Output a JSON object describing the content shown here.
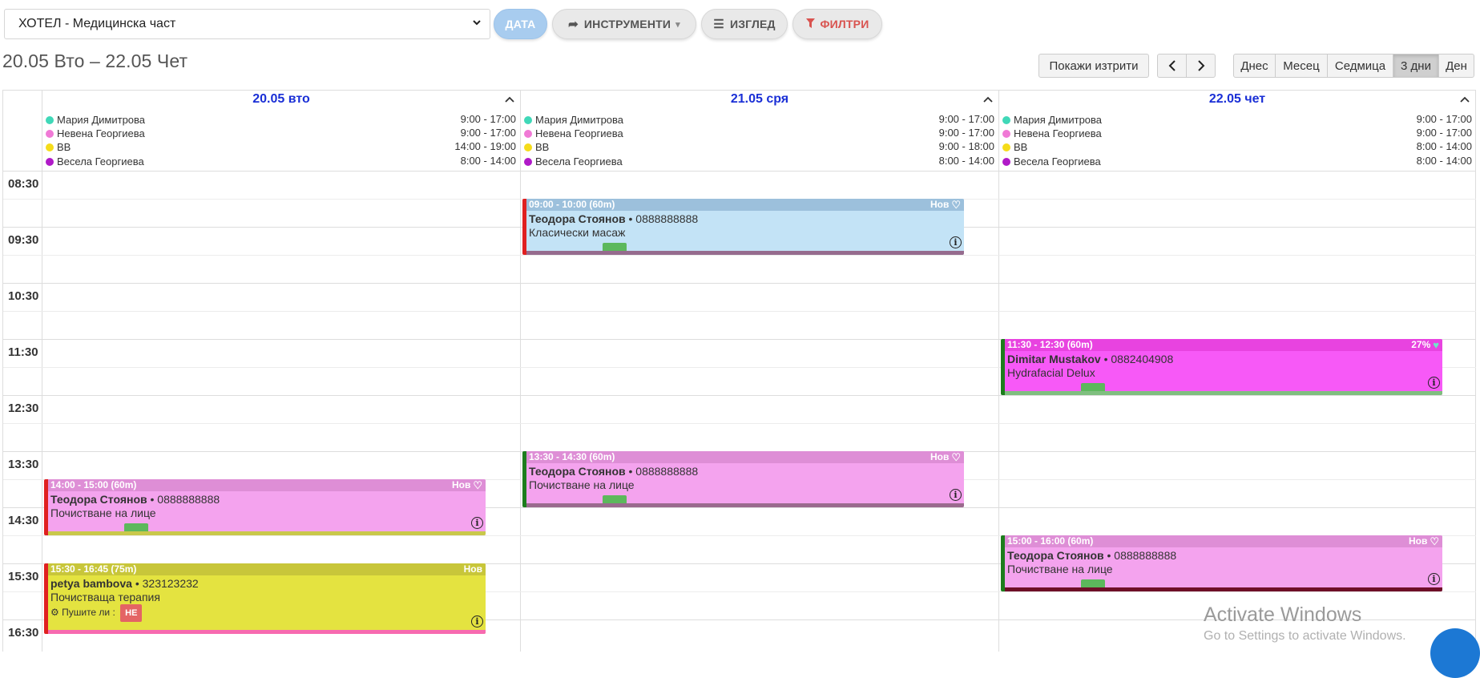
{
  "toolbar": {
    "location_select": "ХОТЕЛ - Медицинска част",
    "date_label": "ДАТА",
    "tools_label": "ИНСТРУМЕНТИ",
    "view_label": "ИЗГЛЕД",
    "filters_label": "ФИЛТРИ"
  },
  "range_title": "20.05 Вто – 22.05 Чет",
  "nav": {
    "show_deleted": "Покажи изтрити",
    "prev": "<",
    "next": ">",
    "views": [
      "Днес",
      "Месец",
      "Седмица",
      "3 дни",
      "Ден"
    ],
    "active_view": "3 дни"
  },
  "days": [
    {
      "title": "20.05 вто",
      "staff": [
        {
          "name": "Мария Димитрова",
          "hours": "9:00 - 17:00",
          "color": "#40d8b8"
        },
        {
          "name": "Невена Георгиева",
          "hours": "9:00 - 17:00",
          "color": "#f07ad6"
        },
        {
          "name": "BB",
          "hours": "14:00 - 19:00",
          "color": "#f5dc1a"
        },
        {
          "name": "Весела Георгиева",
          "hours": "8:00 - 14:00",
          "color": "#b01ac8"
        }
      ]
    },
    {
      "title": "21.05 сря",
      "staff": [
        {
          "name": "Мария Димитрова",
          "hours": "9:00 - 17:00",
          "color": "#40d8b8"
        },
        {
          "name": "Невена Георгиева",
          "hours": "9:00 - 17:00",
          "color": "#f07ad6"
        },
        {
          "name": "BB",
          "hours": "9:00 - 18:00",
          "color": "#f5dc1a"
        },
        {
          "name": "Весела Георгиева",
          "hours": "8:00 - 14:00",
          "color": "#b01ac8"
        }
      ]
    },
    {
      "title": "22.05 чет",
      "staff": [
        {
          "name": "Мария Димитрова",
          "hours": "9:00 - 17:00",
          "color": "#40d8b8"
        },
        {
          "name": "Невена Георгиева",
          "hours": "9:00 - 17:00",
          "color": "#f07ad6"
        },
        {
          "name": "BB",
          "hours": "8:00 - 14:00",
          "color": "#f5dc1a"
        },
        {
          "name": "Весела Георгиева",
          "hours": "8:00 - 14:00",
          "color": "#b01ac8"
        }
      ]
    }
  ],
  "times": [
    "08:30",
    "09:30",
    "10:30",
    "11:30",
    "12:30",
    "13:30",
    "14:30",
    "15:30",
    "16:30"
  ],
  "events": [
    {
      "id": "e1",
      "time": "09:00 - 10:00 (60m)",
      "badge": "Нов",
      "client": "Теодора Стоянов",
      "phone": "• 0888888888",
      "service": "Класически масаж"
    },
    {
      "id": "e2",
      "time": "11:30 - 12:30 (60m)",
      "badge": "27%",
      "client": "Dimitar Mustakov",
      "phone": "• 0882404908",
      "service": "Hydrafacial Delux"
    },
    {
      "id": "e3",
      "time": "13:30 - 14:30 (60m)",
      "badge": "Нов",
      "client": "Теодора Стоянов",
      "phone": "• 0888888888",
      "service": "Почистване на лице"
    },
    {
      "id": "e4",
      "time": "14:00 - 15:00 (60m)",
      "badge": "Нов",
      "client": "Теодора Стоянов",
      "phone": "• 0888888888",
      "service": "Почистване на лице"
    },
    {
      "id": "e5",
      "time": "15:30 - 16:45 (75m)",
      "badge": "Нов",
      "client": "petya bambova",
      "phone": "• 323123232",
      "service": "Почистваща терапия",
      "question": "Пушите ли :",
      "answer": "НЕ"
    },
    {
      "id": "e6",
      "time": "15:00 - 16:00 (60m)",
      "badge": "Нов",
      "client": "Теодора Стоянов",
      "phone": "• 0888888888",
      "service": "Почистване на лице"
    }
  ],
  "watermark": {
    "line1": "Activate Windows",
    "line2": "Go to Settings to activate Windows."
  }
}
